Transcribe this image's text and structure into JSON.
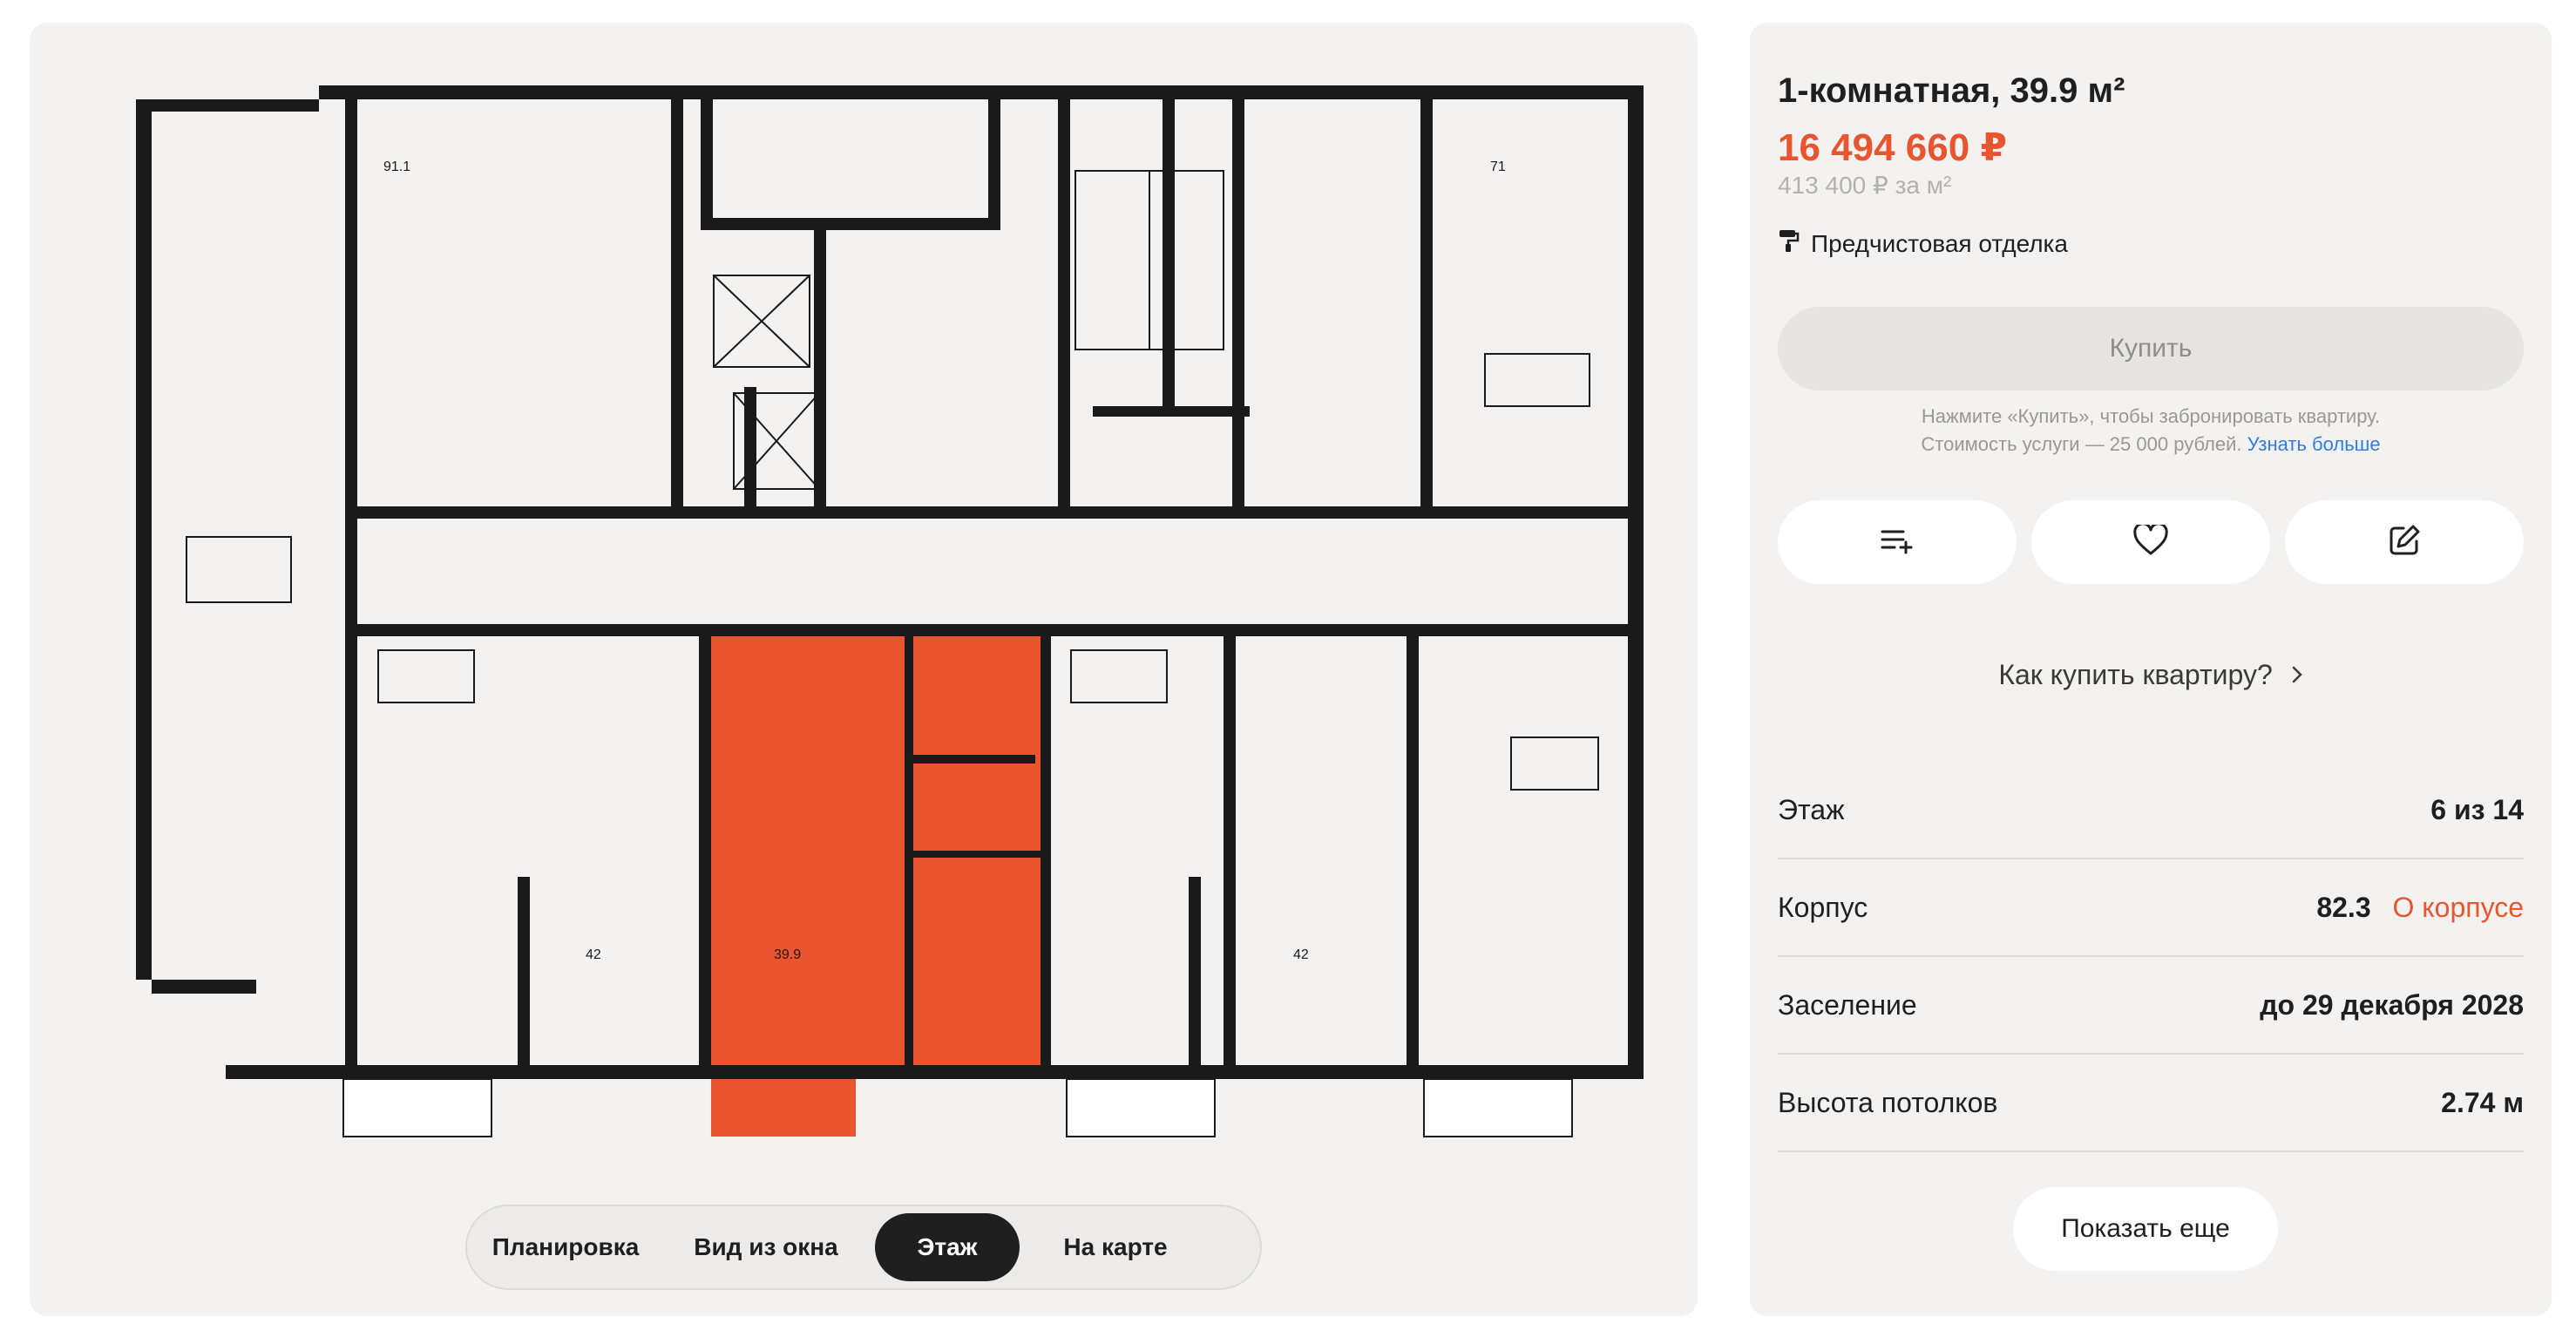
{
  "plan": {
    "apartment_areas": [
      "91.1",
      "71",
      "42",
      "39.9",
      "42"
    ],
    "highlight_color": "#e8552f"
  },
  "view_tabs": [
    {
      "label": "Планировка",
      "active": false
    },
    {
      "label": "Вид из окна",
      "active": false
    },
    {
      "label": "Этаж",
      "active": true
    },
    {
      "label": "На карте",
      "active": false
    }
  ],
  "apartment": {
    "title": "1-комнатная, 39.9 м²",
    "price": "16 494 660 ₽",
    "price_per_m2": "413 400 ₽ за м²",
    "finish": "Предчистовая отделка",
    "finish_icon": "paint-roller-icon"
  },
  "buy": {
    "label": "Купить",
    "note_line1": "Нажмите «Купить», чтобы забронировать квартиру.",
    "note_line2": "Стоимость услуги — 25 000 рублей.",
    "note_link": "Узнать больше"
  },
  "actions": [
    {
      "name": "add-to-list-icon"
    },
    {
      "name": "heart-icon"
    },
    {
      "name": "edit-icon"
    }
  ],
  "how_to_buy": "Как купить квартиру?",
  "details": [
    {
      "label": "Этаж",
      "value": "6 из 14"
    },
    {
      "label": "Корпус",
      "value": "82.3",
      "link": "О корпусе"
    },
    {
      "label": "Заселение",
      "value": "до 29 декабря 2028"
    },
    {
      "label": "Высота потолков",
      "value": "2.74 м"
    }
  ],
  "show_more": "Показать еще",
  "colors": {
    "accent": "#e8552f",
    "link": "#2f7de1",
    "card_bg": "#f3f2f0"
  }
}
